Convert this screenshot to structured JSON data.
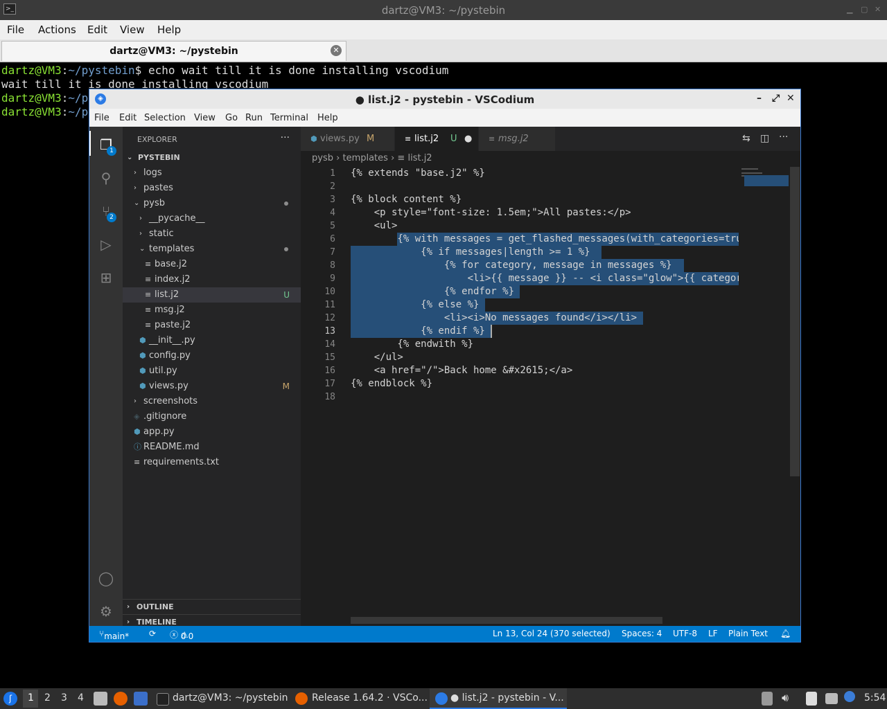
{
  "terminal": {
    "title": "dartz@VM3: ~/pystebin",
    "menu": [
      "File",
      "Actions",
      "Edit",
      "View",
      "Help"
    ],
    "tab_label": "dartz@VM3: ~/pystebin",
    "lines": [
      {
        "user": "dartz@VM3",
        "sep": ":",
        "path": "~/pystebin",
        "cmd": "$ echo wait till it is done installing vscodium"
      },
      {
        "text": "wait till it is done installing vscodium"
      },
      {
        "user": "dartz@VM3",
        "sep": ":",
        "path": "~/p",
        "cmd": ""
      },
      {
        "user": "dartz@VM3",
        "sep": ":",
        "path": "~/p",
        "cmd": ""
      }
    ]
  },
  "vscodium": {
    "title": "● list.j2 - pystebin - VSCodium",
    "menu": [
      "File",
      "Edit",
      "Selection",
      "View",
      "Go",
      "Run",
      "Terminal",
      "Help"
    ],
    "activity_badges": {
      "explorer": "1",
      "scm": "2"
    },
    "sidebar": {
      "header": "EXPLORER",
      "more": "···",
      "root": "PYSTEBIN",
      "tree": [
        {
          "name": "logs",
          "chev": "›"
        },
        {
          "name": "pastes",
          "chev": "›"
        },
        {
          "name": "pysb",
          "chev": "⌄"
        },
        {
          "name": "__pycache__",
          "chev": "›"
        },
        {
          "name": "static",
          "chev": "›"
        },
        {
          "name": "templates",
          "chev": "⌄"
        },
        {
          "name": "base.j2",
          "icon": "≡"
        },
        {
          "name": "index.j2",
          "icon": "≡"
        },
        {
          "name": "list.j2",
          "icon": "≡",
          "status": "U"
        },
        {
          "name": "msg.j2",
          "icon": "≡"
        },
        {
          "name": "paste.j2",
          "icon": "≡"
        },
        {
          "name": "__init__.py",
          "icon": "⬢"
        },
        {
          "name": "config.py",
          "icon": "⬢"
        },
        {
          "name": "util.py",
          "icon": "⬢"
        },
        {
          "name": "views.py",
          "icon": "⬢",
          "status": "M"
        },
        {
          "name": "screenshots",
          "chev": "›"
        },
        {
          "name": ".gitignore",
          "icon": "◈"
        },
        {
          "name": "app.py",
          "icon": "⬢"
        },
        {
          "name": "README.md",
          "icon": "ⓘ"
        },
        {
          "name": "requirements.txt",
          "icon": "≡"
        }
      ],
      "outline": "OUTLINE",
      "timeline": "TIMELINE"
    },
    "tabs": [
      {
        "name": "views.py",
        "status": "M"
      },
      {
        "name": "list.j2",
        "status": "U",
        "dirty": "●"
      },
      {
        "name": "msg.j2"
      }
    ],
    "breadcrumbs": [
      "pysb",
      "templates",
      "list.j2"
    ],
    "code_lines": [
      "{% extends \"base.j2\" %}",
      "",
      "{% block content %}",
      "    <p style=\"font-size: 1.5em;\">All pastes:</p>",
      "    <ul>",
      "        {% with messages = get_flashed_messages(with_categories=tru",
      "            {% if messages|length >= 1 %}",
      "                {% for category, message in messages %}",
      "                    <li>{{ message }} -- <i class=\"glow\">{{ categor",
      "                {% endfor %}",
      "            {% else %}",
      "                <li><i>No messages found</i></li>",
      "            {% endif %}",
      "        {% endwith %}",
      "    </ul>",
      "    <a href=\"/\">Back home &#x2615;</a>",
      "{% endblock %}",
      ""
    ],
    "current_line": 13,
    "status": {
      "branch": "main*",
      "errors": "0",
      "warnings": "0",
      "position": "Ln 13, Col 24 (370 selected)",
      "spaces": "Spaces: 4",
      "encoding": "UTF-8",
      "eol": "LF",
      "language": "Plain Text"
    }
  },
  "taskbar": {
    "workspaces": [
      "1",
      "2",
      "3",
      "4"
    ],
    "windows": [
      "dartz@VM3: ~/pystebin",
      "Release 1.64.2 · VSCo...",
      "● list.j2 - pystebin - V..."
    ],
    "clock": "5:54"
  }
}
